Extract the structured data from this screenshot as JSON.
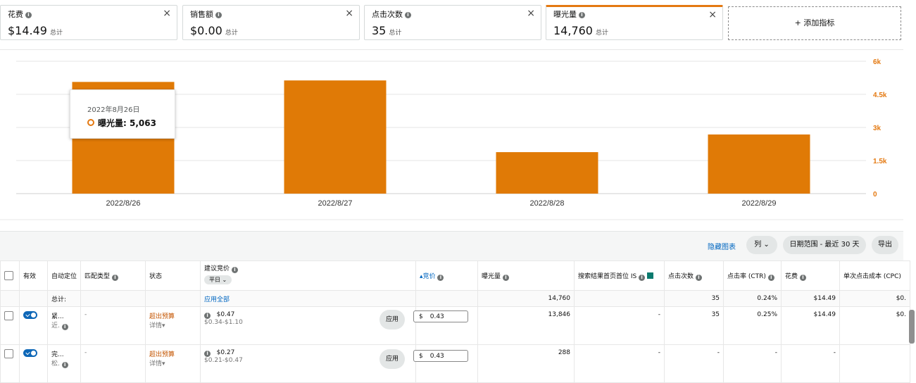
{
  "metrics": [
    {
      "name": "花费",
      "value": "$14.49",
      "sub": "总计",
      "active": false
    },
    {
      "name": "销售额",
      "value": "$0.00",
      "sub": "总计",
      "active": false
    },
    {
      "name": "点击次数",
      "value": "35",
      "sub": "总计",
      "active": false
    },
    {
      "name": "曝光量",
      "value": "14,760",
      "sub": "总计",
      "active": true
    }
  ],
  "add_metric_label": "+ 添加指标",
  "close_glyph": "×",
  "info_glyph": "i",
  "colors": {
    "accent": "#e47911",
    "bar": "#e07a06",
    "link": "#0066c0",
    "budget": "#c45500",
    "toggle": "#0e67b7"
  },
  "chart_data": {
    "type": "bar",
    "categories": [
      "2022/8/26",
      "2022/8/27",
      "2022/8/28",
      "2022/8/29"
    ],
    "series": [
      {
        "name": "曝光量",
        "values": [
          5063,
          5130,
          1880,
          2680
        ]
      }
    ],
    "ylim": [
      0,
      6000
    ],
    "y_ticks": [
      "0",
      "1.5k",
      "3k",
      "4.5k",
      "6k"
    ],
    "y_tick_values": [
      0,
      1500,
      3000,
      4500,
      6000
    ],
    "y_axis_side": "right",
    "grid": true
  },
  "tooltip": {
    "date": "2022年8月26日",
    "label": "曝光量: 5,063"
  },
  "toolbar": {
    "hide_chart": "隐藏图表",
    "columns": "列 ⌄",
    "date_range": "日期范围 - 最近 30 天",
    "export": "导出"
  },
  "table": {
    "headers": {
      "active": "有效",
      "auto_target": "自动定位",
      "match_type": "匹配类型",
      "status": "状态",
      "suggested_bid": "建议竞价",
      "bid_period": "平日 ⌄",
      "bid": "▴竞价",
      "impressions": "曝光量",
      "top_is": "搜索结果首页首位 IS",
      "clicks": "点击次数",
      "ctr": "点击率 (CTR)",
      "spend": "花费",
      "cpc": "单次点击成本 (CPC)"
    },
    "total": {
      "label": "总计:",
      "apply_all": "应用全部",
      "impressions": "14,760",
      "clicks": "35",
      "ctr": "0.24%",
      "spend": "$14.49",
      "cpc": "$0."
    },
    "rows": [
      {
        "target_line1": "紧...",
        "target_line2": "近.",
        "match": "-",
        "status": "超出预算",
        "details": "详情▾",
        "suggested": "$0.47",
        "range": "$0.34-$1.10",
        "apply": "应用",
        "currency": "$",
        "bid": "0.43",
        "impressions": "13,846",
        "top_is": "-",
        "clicks": "35",
        "ctr": "0.25%",
        "spend": "$14.49",
        "cpc": "$0."
      },
      {
        "target_line1": "完...",
        "target_line2": "松.",
        "match": "-",
        "status": "超出预算",
        "details": "详情▾",
        "suggested": "$0.27",
        "range": "$0.21-$0.47",
        "apply": "应用",
        "currency": "$",
        "bid": "0.43",
        "impressions": "288",
        "top_is": "-",
        "clicks": "-",
        "ctr": "-",
        "spend": "-",
        "cpc": ""
      }
    ]
  }
}
